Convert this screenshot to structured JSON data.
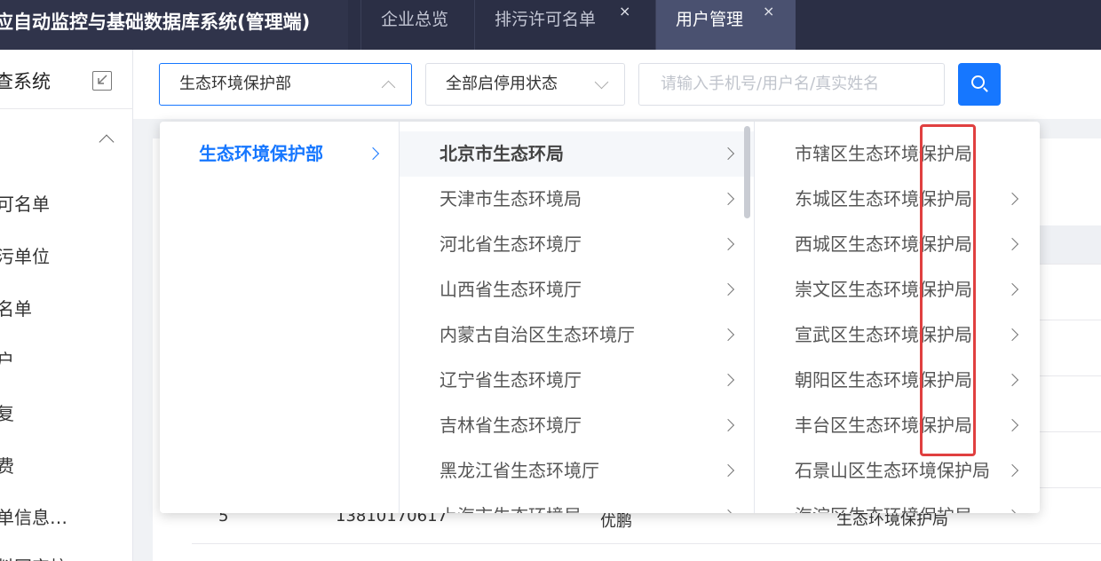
{
  "header": {
    "app_title": "应自动监控与基础数据库系统(管理端)",
    "tabs": [
      {
        "label": "企业总览",
        "closable": false,
        "active": false
      },
      {
        "label": "排污许可名单",
        "closable": true,
        "active": false
      },
      {
        "label": "用户管理",
        "closable": true,
        "active": true
      }
    ],
    "close_glyph": "×"
  },
  "sidebar": {
    "title": "查系统",
    "items": [
      "可名单",
      "污单位",
      "名单",
      "户",
      "复",
      "费",
      "单信息…",
      "料固定校"
    ]
  },
  "filters": {
    "department_select": "生态环境保护部",
    "status_select": "全部启停用状态",
    "search_placeholder": "请输入手机号/用户名/真实姓名"
  },
  "table_peek": {
    "row_index": "5",
    "phone": "13810170617",
    "unit": "上海市生态环境局",
    "name": "优鹏",
    "org": "生态环境保护局"
  },
  "cascader": {
    "level1": [
      {
        "label": "生态环境保护部",
        "has_children": true
      }
    ],
    "level2": [
      {
        "label": "北京市生态环局",
        "has_children": true
      },
      {
        "label": "天津市生态环境局",
        "has_children": true
      },
      {
        "label": "河北省生态环境厅",
        "has_children": true
      },
      {
        "label": "山西省生态环境厅",
        "has_children": true
      },
      {
        "label": "内蒙古自治区生态环境厅",
        "has_children": true
      },
      {
        "label": "辽宁省生态环境厅",
        "has_children": true
      },
      {
        "label": "吉林省生态环境厅",
        "has_children": true
      },
      {
        "label": "黑龙江省生态环境厅",
        "has_children": true
      },
      {
        "label": "上海市生态环境局",
        "has_children": true
      }
    ],
    "level3": [
      {
        "label": "市辖区生态环境保护局",
        "has_children": false
      },
      {
        "label": "东城区生态环境保护局",
        "has_children": true
      },
      {
        "label": "西城区生态环境保护局",
        "has_children": true
      },
      {
        "label": "崇文区生态环境保护局",
        "has_children": true
      },
      {
        "label": "宣武区生态环境保护局",
        "has_children": true
      },
      {
        "label": "朝阳区生态环境保护局",
        "has_children": true
      },
      {
        "label": "丰台区生态环境保护局",
        "has_children": true
      },
      {
        "label": "石景山区生态环境保护局",
        "has_children": true
      },
      {
        "label": "海淀区生态环境保护局",
        "has_children": true
      }
    ]
  },
  "colors": {
    "accent": "#1677ff",
    "header_bg": "#2b2f45",
    "highlight_border": "#e04040"
  }
}
